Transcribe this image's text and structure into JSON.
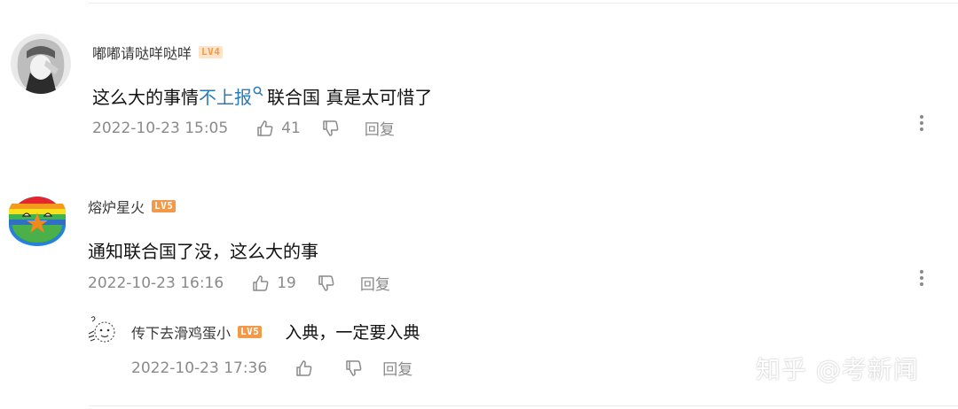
{
  "comments": [
    {
      "user": "嘟嘟请哒咩哒咩",
      "level": "LV4",
      "text_before": "这么大的事情",
      "link_text": "不上报",
      "text_after": "联合国 真是太可惜了",
      "date": "2022-10-23 15:05",
      "likes": "41",
      "reply_label": "回复"
    },
    {
      "user": "熔炉星火",
      "level": "LV5",
      "text": "通知联合国了没，这么大的事",
      "date": "2022-10-23 16:16",
      "likes": "19",
      "reply_label": "回复"
    }
  ],
  "reply": {
    "user": "传下去滑鸡蛋小",
    "level": "LV5",
    "text": "入典，一定要入典",
    "date": "2022-10-23 17:36",
    "reply_label": "回复"
  },
  "watermark": "知乎 @考新闻",
  "colors": {
    "link": "#2b7ab8",
    "meta": "#8a8a8a",
    "badge_orange": "#f29a4a"
  }
}
